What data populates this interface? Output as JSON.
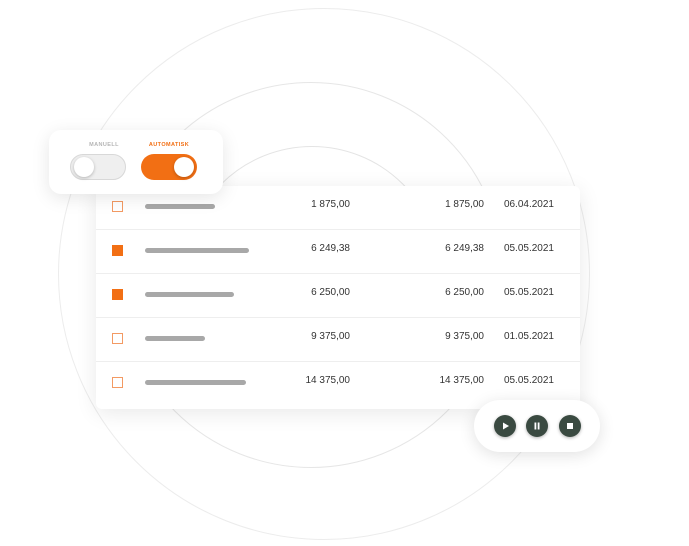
{
  "toggle": {
    "manual_label": "MANUELL",
    "auto_label": "AUTOMATISK",
    "active": "auto"
  },
  "colors": {
    "accent": "#f26f14",
    "media_button": "#3a4a41"
  },
  "table": {
    "rows": [
      {
        "checked": false,
        "amount1": "1 875,00",
        "amount2": "1 875,00",
        "date": "06.04.2021"
      },
      {
        "checked": true,
        "amount1": "6 249,38",
        "amount2": "6 249,38",
        "date": "05.05.2021"
      },
      {
        "checked": true,
        "amount1": "6 250,00",
        "amount2": "6 250,00",
        "date": "05.05.2021"
      },
      {
        "checked": false,
        "amount1": "9 375,00",
        "amount2": "9 375,00",
        "date": "01.05.2021"
      },
      {
        "checked": false,
        "amount1": "14 375,00",
        "amount2": "14 375,00",
        "date": "05.05.2021"
      }
    ]
  },
  "media": {
    "buttons": [
      "play-icon",
      "pause-icon",
      "stop-icon"
    ]
  }
}
